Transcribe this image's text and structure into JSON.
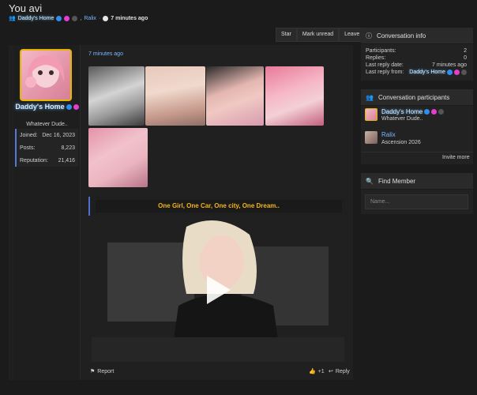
{
  "page": {
    "title": "You avi",
    "starter_name": "Daddy's Home",
    "separator": ",",
    "other_participant": "Ralix",
    "dot": "·",
    "time_ago": "7 minutes ago"
  },
  "actions": {
    "star": "Star",
    "mark_unread": "Mark unread",
    "leave": "Leave"
  },
  "post": {
    "author": "Daddy's Home",
    "user_title": "Whatever Dude..",
    "stats": [
      {
        "label": "Joined:",
        "value": "Dec 16, 2023"
      },
      {
        "label": "Posts:",
        "value": "8,223"
      },
      {
        "label": "Reputation:",
        "value": "21,416"
      }
    ],
    "time": "7 minutes ago",
    "quote": "One Girl, One Car, One city, One Dream..",
    "report": "Report",
    "reaction": "+1",
    "reply": "Reply"
  },
  "sidebar": {
    "info": {
      "title": "Conversation info",
      "rows": [
        {
          "label": "Participants:",
          "value": "2"
        },
        {
          "label": "Replies:",
          "value": "0"
        },
        {
          "label": "Last reply date:",
          "value": "7 minutes ago"
        },
        {
          "label": "Last reply from:",
          "value": "Daddy's Home"
        }
      ]
    },
    "participants": {
      "title": "Conversation participants",
      "items": [
        {
          "name": "Daddy's Home",
          "title": "Whatever Dude.."
        },
        {
          "name": "Ralix",
          "title": "Ascension 2026"
        }
      ],
      "invite": "Invite more"
    },
    "find": {
      "title": "Find Member",
      "placeholder": "Name..."
    }
  },
  "colors": {
    "accent_blue": "#79b7ff",
    "gold_text": "#f3b51a",
    "border_gold": "#e5b500",
    "stat_border": "#5477d8"
  }
}
